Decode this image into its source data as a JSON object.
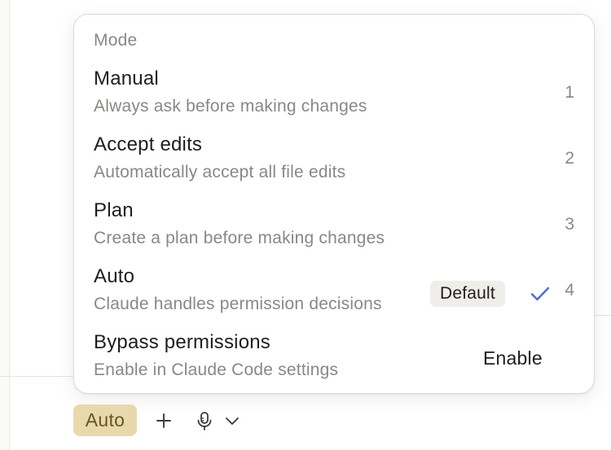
{
  "menu": {
    "heading": "Mode",
    "items": [
      {
        "title": "Manual",
        "description": "Always ask before making changes",
        "shortcut": "1"
      },
      {
        "title": "Accept edits",
        "description": "Automatically accept all file edits",
        "shortcut": "2"
      },
      {
        "title": "Plan",
        "description": "Create a plan before making changes",
        "shortcut": "3"
      },
      {
        "title": "Auto",
        "description": "Claude handles permission decisions",
        "badge": "Default",
        "selected": true,
        "shortcut": "4"
      },
      {
        "title": "Bypass permissions",
        "description": "Enable in Claude Code settings",
        "action": "Enable"
      }
    ]
  },
  "toolbar": {
    "mode_chip": "Auto",
    "icons": [
      "plus-icon",
      "microphone-icon",
      "chevron-down-icon"
    ]
  },
  "colors": {
    "accent_check": "#4a6fc9",
    "chip_background": "#e8d9ac",
    "chip_text": "#6b5520",
    "muted_text": "#8a8883"
  }
}
